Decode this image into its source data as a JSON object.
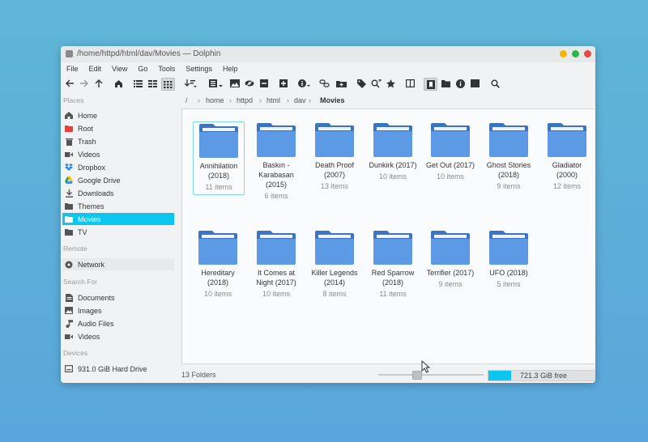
{
  "window": {
    "title": "/home/httpd/html/dav/Movies — Dolphin",
    "controls": [
      {
        "name": "minimize",
        "color": "#f4b400"
      },
      {
        "name": "maximize",
        "color": "#2fb34a"
      },
      {
        "name": "close",
        "color": "#e84a4a"
      }
    ]
  },
  "menu": [
    "File",
    "Edit",
    "View",
    "Go",
    "Tools",
    "Settings",
    "Help"
  ],
  "toolbar": {
    "icons": [
      "back-icon",
      "forward-icon",
      "up-icon",
      "home-icon",
      "details-view-icon",
      "compact-view-icon",
      "icons-view-icon",
      "sort-icon",
      "view-options-icon",
      "preview-icon",
      "hidden-files-icon",
      "remove-icon",
      "add-icon",
      "info-menu-icon",
      "link-icon",
      "new-folder-icon",
      "find-icon",
      "tag-icon",
      "star-icon",
      "split-icon",
      "bookmark-panel-icon",
      "folders-panel-icon",
      "information-panel-icon",
      "terminal-panel-icon",
      "search-icon"
    ]
  },
  "sidebar": {
    "places_header": "Places",
    "places": [
      {
        "label": "Home",
        "icon": "home-icon"
      },
      {
        "label": "Root",
        "icon": "root-folder-icon"
      },
      {
        "label": "Trash",
        "icon": "trash-icon"
      },
      {
        "label": "Videos",
        "icon": "video-icon"
      },
      {
        "label": "Dropbox",
        "icon": "dropbox-icon"
      },
      {
        "label": "Google Drive",
        "icon": "google-drive-icon"
      },
      {
        "label": "Downloads",
        "icon": "download-icon"
      },
      {
        "label": "Themes",
        "icon": "folder-icon"
      },
      {
        "label": "Movies",
        "icon": "folder-icon",
        "selected": true
      },
      {
        "label": "TV",
        "icon": "folder-icon"
      }
    ],
    "remote_header": "Remote",
    "remote": [
      {
        "label": "Network",
        "icon": "network-icon"
      }
    ],
    "search_header": "Search For",
    "search": [
      {
        "label": "Documents",
        "icon": "document-icon"
      },
      {
        "label": "Images",
        "icon": "image-icon"
      },
      {
        "label": "Audio Files",
        "icon": "audio-icon"
      },
      {
        "label": "Videos",
        "icon": "video-icon"
      }
    ],
    "devices_header": "Devices",
    "devices": [
      {
        "label": "931.0 GiB Hard Drive",
        "icon": "hard-drive-icon"
      }
    ]
  },
  "breadcrumb": {
    "root": "/",
    "parts": [
      "home",
      "httpd",
      "html",
      "dav"
    ],
    "current": "Movies"
  },
  "folders": [
    {
      "name": "Annihilation (2018)",
      "count": "11 items",
      "selected": true
    },
    {
      "name": "Baskın - Karabasan (2015)",
      "count": "6 items"
    },
    {
      "name": "Death Proof (2007)",
      "count": "13 items"
    },
    {
      "name": "Dunkirk (2017)",
      "count": "10 items"
    },
    {
      "name": "Get Out (2017)",
      "count": "10 items"
    },
    {
      "name": "Ghost Stories (2018)",
      "count": "9 items"
    },
    {
      "name": "Gladiator (2000)",
      "count": "12 items"
    },
    {
      "name": "Hereditary (2018)",
      "count": "10 items"
    },
    {
      "name": "It Comes at Night (2017)",
      "count": "10 items"
    },
    {
      "name": "Killer Legends (2014)",
      "count": "8 items"
    },
    {
      "name": "Red Sparrow (2018)",
      "count": "11 items"
    },
    {
      "name": "Terrifier (2017)",
      "count": "9 items"
    },
    {
      "name": "UFO (2018)",
      "count": "5 items"
    }
  ],
  "status": {
    "folders_count": "13 Folders",
    "zoom_fraction": 0.35,
    "free_space": "721.3 GiB free",
    "used_fraction": 0.21,
    "accent": "#0cc6f0"
  }
}
